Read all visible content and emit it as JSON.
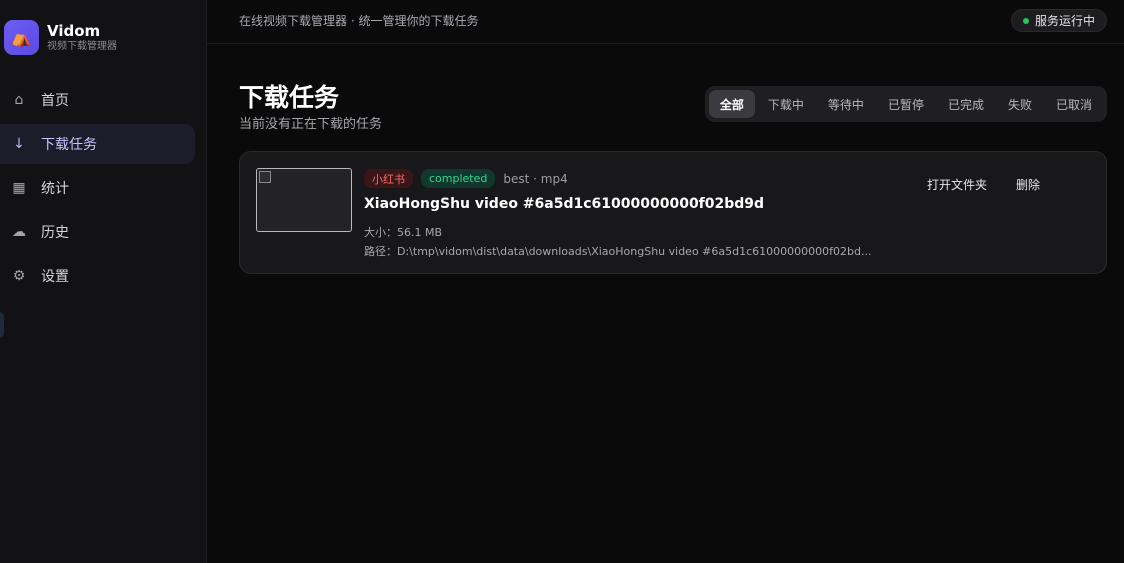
{
  "app": {
    "name": "Vidom",
    "subtitle": "视频下载管理器",
    "logo_glyph": "⛺"
  },
  "sidebar": {
    "items": [
      {
        "label": "首页",
        "icon": "home-icon",
        "glyph": "⌂",
        "active": false
      },
      {
        "label": "下载任务",
        "icon": "download-icon",
        "glyph": "↓",
        "active": true
      },
      {
        "label": "统计",
        "icon": "grid-chart-icon",
        "glyph": "▦",
        "active": false
      },
      {
        "label": "历史",
        "icon": "history-icon",
        "glyph": "☁",
        "active": false
      },
      {
        "label": "设置",
        "icon": "gear-icon",
        "glyph": "⚙",
        "active": false
      }
    ]
  },
  "topbar": {
    "title": "在线视频下载管理器 · 统一管理你的下载任务",
    "status": "服务运行中",
    "status_color": "#22c55e"
  },
  "page": {
    "title": "下载任务",
    "subtitle": "当前没有正在下载的任务"
  },
  "filters": [
    {
      "label": "全部",
      "active": true
    },
    {
      "label": "下载中",
      "active": false
    },
    {
      "label": "等待中",
      "active": false
    },
    {
      "label": "已暂停",
      "active": false
    },
    {
      "label": "已完成",
      "active": false
    },
    {
      "label": "失败",
      "active": false
    },
    {
      "label": "已取消",
      "active": false
    }
  ],
  "tasks": [
    {
      "source": "小红书",
      "status": "completed",
      "format": "best · mp4",
      "title": "XiaoHongShu video #6a5d1c61000000000f02bd9d",
      "size": "大小：56.1 MB",
      "path": "路径：D:\\tmp\\vidom\\dist\\data\\downloads\\XiaoHongShu video #6a5d1c61000000000f02bd...",
      "open_folder_label": "打开文件夹",
      "delete_label": "删除"
    }
  ],
  "colors": {
    "accent": "#6d5cf6",
    "source_tag": "#f36b6e",
    "status_completed": "#34d399"
  }
}
